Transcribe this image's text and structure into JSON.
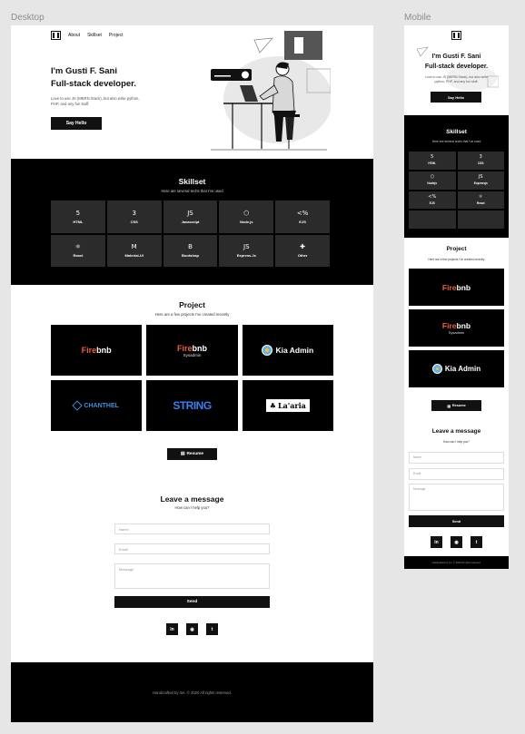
{
  "frames": {
    "desktop_label": "Desktop",
    "mobile_label": "Mobile"
  },
  "nav": {
    "about": "About",
    "skillset": "Skillset",
    "project": "Project"
  },
  "hero": {
    "title_line1": "I'm Gusti F. Sani",
    "title_line2": "Full-stack developer.",
    "description": "Love to use JS (MERN Stack), but also write python, PHP, and any fun stuff.",
    "button": "Say Hello"
  },
  "skillset": {
    "title": "Skillset",
    "subtitle": "Here are several techs that I've used",
    "items": [
      {
        "name": "HTML",
        "icon": "5"
      },
      {
        "name": "CSS",
        "icon": "3"
      },
      {
        "name": "Javascript",
        "icon": "JS"
      },
      {
        "name": "Node.js",
        "icon": "⬡"
      },
      {
        "name": "EJS",
        "icon": "<%"
      },
      {
        "name": "React",
        "icon": "⚛"
      },
      {
        "name": "Material-UI",
        "icon": "M"
      },
      {
        "name": "Bootstrap",
        "icon": "B"
      },
      {
        "name": "Express.Js",
        "icon": "JS"
      },
      {
        "name": "Other",
        "icon": "✚"
      }
    ],
    "mobile_items": [
      {
        "name": "HTML",
        "icon": "5"
      },
      {
        "name": "CSS",
        "icon": "3"
      },
      {
        "name": "Nodejs",
        "icon": "⬡"
      },
      {
        "name": "Expressjs",
        "icon": "JS"
      },
      {
        "name": "EJS",
        "icon": "<%"
      },
      {
        "name": "React",
        "icon": "⚛"
      },
      {
        "name": "",
        "icon": ""
      },
      {
        "name": "",
        "icon": ""
      }
    ]
  },
  "project": {
    "title": "Project",
    "subtitle": "Here are a few projects I've created recently",
    "cards": {
      "firebnb": {
        "accent": "Fire",
        "rest": "bnb"
      },
      "firebnb_sysadmin": {
        "accent": "Fire",
        "rest": "bnb",
        "sub": "Sysadmin"
      },
      "kia_admin": "Kia Admin",
      "chanthel": "CHANTHEL",
      "string": "STRING",
      "laaria": "La'aria"
    }
  },
  "resume": {
    "label": "Resume",
    "icon": "document-icon"
  },
  "message": {
    "title": "Leave a message",
    "subtitle": "How can I help you?",
    "name_placeholder": "Name",
    "email_placeholder": "Email",
    "message_placeholder": "Message",
    "send": "Send"
  },
  "social": {
    "linkedin": "in",
    "github": "◉",
    "twitter": "t"
  },
  "footer": {
    "text": "Handcrafted by me. © 2020 All rights reserved."
  }
}
